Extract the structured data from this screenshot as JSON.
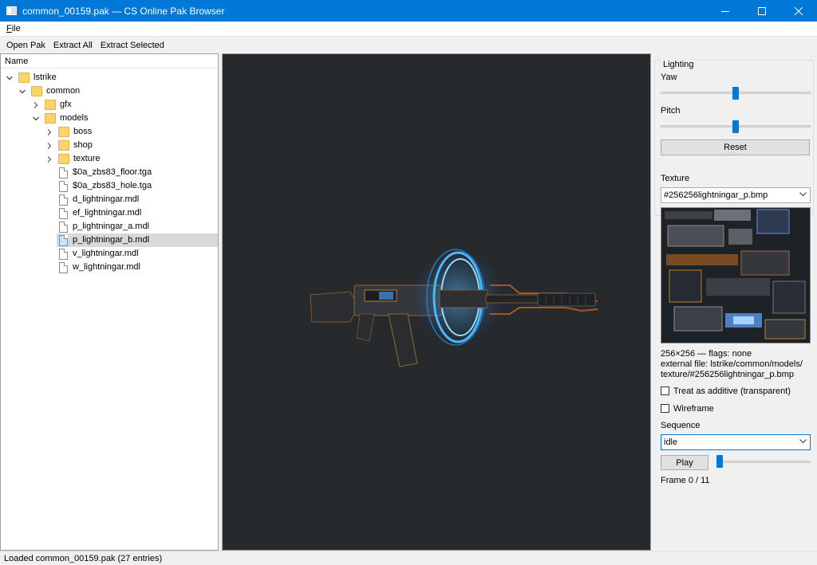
{
  "window": {
    "title": "common_00159.pak — CS Online Pak Browser",
    "accent_color": "#0078d7"
  },
  "menubar": {
    "file_prefix": "F",
    "file_rest": "ile"
  },
  "toolbar": {
    "open_pak": "Open Pak",
    "extract_all": "Extract All",
    "extract_selected": "Extract Selected"
  },
  "tree": {
    "header": "Name",
    "items": [
      {
        "label": "lstrike",
        "type": "folder",
        "expanded": true
      },
      {
        "label": "common",
        "type": "folder",
        "expanded": true
      },
      {
        "label": "gfx",
        "type": "folder",
        "expanded": false
      },
      {
        "label": "models",
        "type": "folder",
        "expanded": true
      },
      {
        "label": "boss",
        "type": "folder",
        "expanded": false
      },
      {
        "label": "shop",
        "type": "folder",
        "expanded": false
      },
      {
        "label": "texture",
        "type": "folder",
        "expanded": false
      },
      {
        "label": "$0a_zbs83_floor.tga",
        "type": "file"
      },
      {
        "label": "$0a_zbs83_hole.tga",
        "type": "file"
      },
      {
        "label": "d_lightningar.mdl",
        "type": "file"
      },
      {
        "label": "ef_lightningar.mdl",
        "type": "file"
      },
      {
        "label": "p_lightningar_a.mdl",
        "type": "file"
      },
      {
        "label": "p_lightningar_b.mdl",
        "type": "file",
        "selected": true
      },
      {
        "label": "v_lightningar.mdl",
        "type": "file"
      },
      {
        "label": "w_lightningar.mdl",
        "type": "file"
      }
    ]
  },
  "lighting": {
    "title": "Lighting",
    "yaw_label": "Yaw",
    "yaw_value": 0.5,
    "pitch_label": "Pitch",
    "pitch_value": 0.5,
    "reset_label": "Reset"
  },
  "texture": {
    "label": "Texture",
    "selected": "#256256lightningar_p.bmp",
    "info_line1": "256×256 — flags: none",
    "info_line2": "external file: lstrike/common/models/",
    "info_line3": "texture/#256256lightningar_p.bmp",
    "additive_label": "Treat as additive (transparent)",
    "additive_checked": false,
    "wireframe_label": "Wireframe",
    "wireframe_checked": false
  },
  "sequence": {
    "label": "Sequence",
    "selected": "idle",
    "play_label": "Play",
    "frame_text": "Frame 0 / 11",
    "frame_progress": 0
  },
  "status": {
    "text": "Loaded common_00159.pak (27 entries)"
  }
}
